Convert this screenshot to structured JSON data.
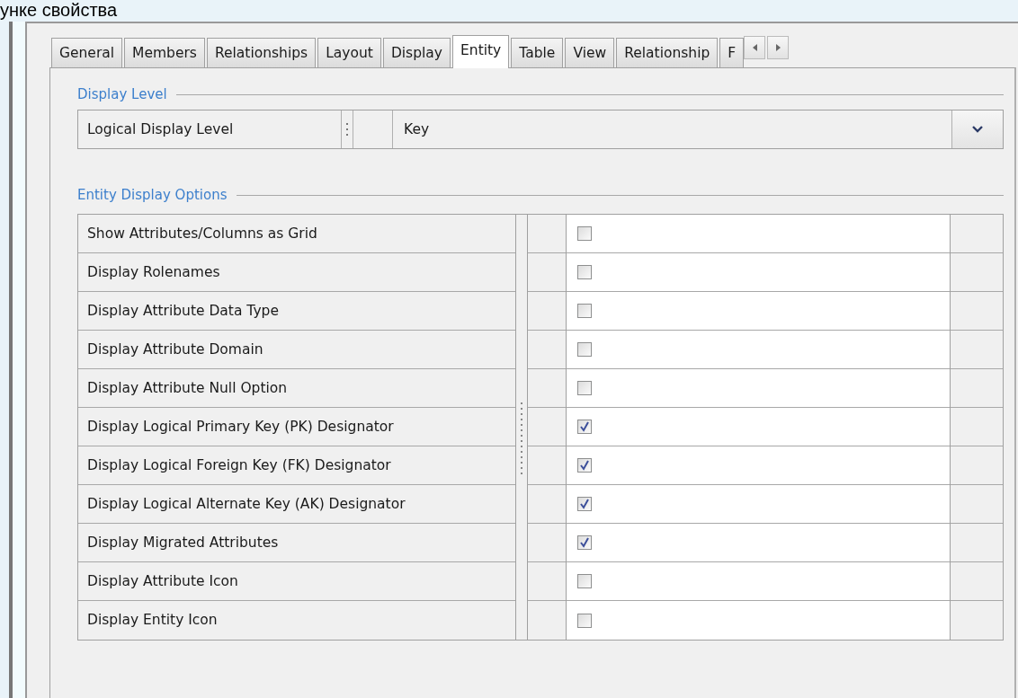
{
  "caption": "унке свойства",
  "tabs": [
    {
      "label": "General",
      "selected": false
    },
    {
      "label": "Members",
      "selected": false
    },
    {
      "label": "Relationships",
      "selected": false
    },
    {
      "label": "Layout",
      "selected": false
    },
    {
      "label": "Display",
      "selected": false
    },
    {
      "label": "Entity",
      "selected": true
    },
    {
      "label": "Table",
      "selected": false
    },
    {
      "label": "View",
      "selected": false
    },
    {
      "label": "Relationship",
      "selected": false
    },
    {
      "label": "F",
      "selected": false
    }
  ],
  "display_level": {
    "heading": "Display Level",
    "label": "Logical Display Level",
    "value": "Key"
  },
  "entity_display_options": {
    "heading": "Entity Display Options",
    "rows": [
      {
        "label": "Show Attributes/Columns as Grid",
        "checked": false
      },
      {
        "label": "Display Rolenames",
        "checked": false
      },
      {
        "label": "Display Attribute Data Type",
        "checked": false
      },
      {
        "label": "Display Attribute Domain",
        "checked": false
      },
      {
        "label": "Display Attribute Null Option",
        "checked": false
      },
      {
        "label": "Display Logical Primary Key (PK) Designator",
        "checked": true
      },
      {
        "label": "Display Logical Foreign Key (FK) Designator",
        "checked": true
      },
      {
        "label": "Display Logical Alternate Key (AK) Designator",
        "checked": true
      },
      {
        "label": "Display Migrated Attributes",
        "checked": true
      },
      {
        "label": "Display Attribute Icon",
        "checked": false
      },
      {
        "label": "Display Entity Icon",
        "checked": false
      }
    ]
  }
}
